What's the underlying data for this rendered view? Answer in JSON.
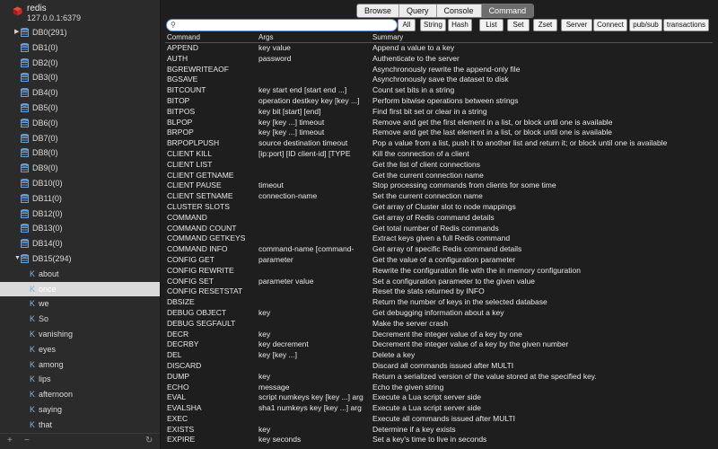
{
  "connection": {
    "name": "redis",
    "address": "127.0.0.1:6379"
  },
  "databases": [
    {
      "label": "DB0(291)",
      "collapsed": true
    },
    {
      "label": "DB1(0)"
    },
    {
      "label": "DB2(0)"
    },
    {
      "label": "DB3(0)"
    },
    {
      "label": "DB4(0)"
    },
    {
      "label": "DB5(0)"
    },
    {
      "label": "DB6(0)"
    },
    {
      "label": "DB7(0)"
    },
    {
      "label": "DB8(0)"
    },
    {
      "label": "DB9(0)"
    },
    {
      "label": "DB10(0)"
    },
    {
      "label": "DB11(0)"
    },
    {
      "label": "DB12(0)"
    },
    {
      "label": "DB13(0)"
    },
    {
      "label": "DB14(0)"
    },
    {
      "label": "DB15(294)",
      "expanded": true
    }
  ],
  "keys": [
    {
      "name": "about"
    },
    {
      "name": "once",
      "selected": true
    },
    {
      "name": "we"
    },
    {
      "name": "So"
    },
    {
      "name": "vanishing"
    },
    {
      "name": "eyes"
    },
    {
      "name": "among"
    },
    {
      "name": "lips"
    },
    {
      "name": "afternoon"
    },
    {
      "name": "saying"
    },
    {
      "name": "that"
    }
  ],
  "key_icon_letter": "K",
  "sidebar_footer": {
    "add": "+",
    "remove": "−",
    "refresh": "↻"
  },
  "tabs": [
    {
      "label": "Browse"
    },
    {
      "label": "Query"
    },
    {
      "label": "Console"
    },
    {
      "label": "Command",
      "active": true
    }
  ],
  "search": {
    "value": "",
    "placeholder": ""
  },
  "filters": [
    "All",
    "String",
    "Hash",
    "List",
    "Set",
    "Zset",
    "Server",
    "Connect",
    "pub/sub",
    "transactions"
  ],
  "table": {
    "headers": [
      "Command",
      "Args",
      "Summary"
    ],
    "rows": [
      [
        "APPEND",
        "key value",
        "Append a value to a key"
      ],
      [
        "AUTH",
        "password",
        "Authenticate to the server"
      ],
      [
        "BGREWRITEAOF",
        "",
        "Asynchronously rewrite the append-only file"
      ],
      [
        "BGSAVE",
        "",
        "Asynchronously save the dataset to disk"
      ],
      [
        "BITCOUNT",
        "key start end [start end ...]",
        "Count set bits in a string"
      ],
      [
        "BITOP",
        "operation destkey key [key ...]",
        "Perform bitwise operations between strings"
      ],
      [
        "BITPOS",
        "key bit [start] [end]",
        "Find first bit set or clear in a string"
      ],
      [
        "BLPOP",
        "key [key ...] timeout",
        "Remove and get the first element in a list, or block until one is available"
      ],
      [
        "BRPOP",
        "key [key ...] timeout",
        "Remove and get the last element in a list, or block until one is available"
      ],
      [
        "BRPOPLPUSH",
        "source destination timeout",
        "Pop a value from a list, push it to another list and return it; or block until one is available"
      ],
      [
        "CLIENT KILL",
        "[ip:port] [ID client-id] [TYPE",
        "Kill the connection of a client"
      ],
      [
        "CLIENT LIST",
        "",
        "Get the list of client connections"
      ],
      [
        "CLIENT GETNAME",
        "",
        "Get the current connection name"
      ],
      [
        "CLIENT PAUSE",
        "timeout",
        "Stop processing commands from clients for some time"
      ],
      [
        "CLIENT SETNAME",
        "connection-name",
        "Set the current connection name"
      ],
      [
        "CLUSTER SLOTS",
        "",
        "Get array of Cluster slot to node mappings"
      ],
      [
        "COMMAND",
        "",
        "Get array of Redis command details"
      ],
      [
        "COMMAND COUNT",
        "",
        "Get total number of Redis commands"
      ],
      [
        "COMMAND GETKEYS",
        "",
        "Extract keys given a full Redis command"
      ],
      [
        "COMMAND INFO",
        "command-name [command-",
        "Get array of specific Redis command details"
      ],
      [
        "CONFIG GET",
        "parameter",
        "Get the value of a configuration parameter"
      ],
      [
        "CONFIG REWRITE",
        "",
        "Rewrite the configuration file with the in memory configuration"
      ],
      [
        "CONFIG SET",
        "parameter value",
        "Set a configuration parameter to the given value"
      ],
      [
        "CONFIG RESETSTAT",
        "",
        "Reset the stats returned by INFO"
      ],
      [
        "DBSIZE",
        "",
        "Return the number of keys in the selected database"
      ],
      [
        "DEBUG OBJECT",
        "key",
        "Get debugging information about a key"
      ],
      [
        "DEBUG SEGFAULT",
        "",
        "Make the server crash"
      ],
      [
        "DECR",
        "key",
        "Decrement the integer value of a key by one"
      ],
      [
        "DECRBY",
        "key decrement",
        "Decrement the integer value of a key by the given number"
      ],
      [
        "DEL",
        "key [key ...]",
        "Delete a key"
      ],
      [
        "DISCARD",
        "",
        "Discard all commands issued after MULTI"
      ],
      [
        "DUMP",
        "key",
        "Return a serialized version of the value stored at the specified key."
      ],
      [
        "ECHO",
        "message",
        "Echo the given string"
      ],
      [
        "EVAL",
        "script numkeys key [key ...] arg",
        "Execute a Lua script server side"
      ],
      [
        "EVALSHA",
        "sha1 numkeys key [key ...] arg",
        "Execute a Lua script server side"
      ],
      [
        "EXEC",
        "",
        "Execute all commands issued after MULTI"
      ],
      [
        "EXISTS",
        "key",
        "Determine if a key exists"
      ],
      [
        "EXPIRE",
        "key seconds",
        "Set a key's time to live in seconds"
      ]
    ]
  },
  "colors": {
    "accent": "#5a8ed0",
    "selection": "#dadada",
    "key_icon": "#7fb3e6",
    "db_icon": "#6a9fd8",
    "logo": "#d62c2c"
  }
}
